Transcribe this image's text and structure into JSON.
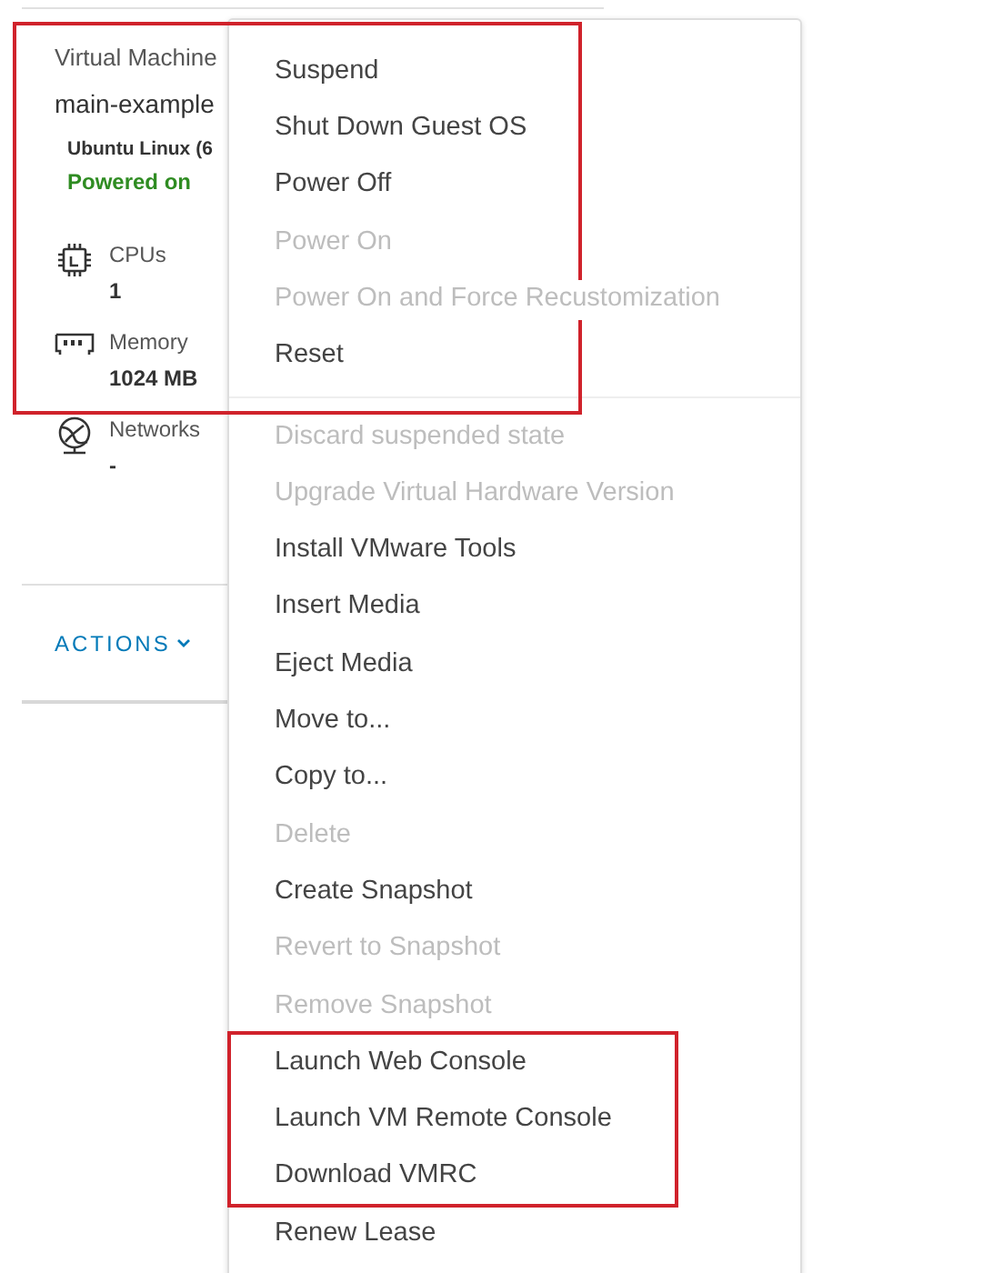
{
  "card": {
    "type_label": "Virtual Machine",
    "name": "main-example",
    "os": "Ubuntu Linux (6",
    "status": "Powered on",
    "specs": [
      {
        "kind": "cpu",
        "label": "CPUs",
        "value": "1"
      },
      {
        "kind": "memory",
        "label": "Memory",
        "value": "1024 MB"
      },
      {
        "kind": "network",
        "label": "Networks",
        "value": "-"
      }
    ],
    "actions_button": "ACTIONS"
  },
  "menu": {
    "sections": [
      [
        {
          "label": "Suspend",
          "disabled": false
        },
        {
          "label": "Shut Down Guest OS",
          "disabled": false
        },
        {
          "label": "Power Off",
          "disabled": false
        },
        {
          "label": "Power On",
          "disabled": true
        },
        {
          "label": "Power On and Force Recustomization",
          "disabled": true
        },
        {
          "label": "Reset",
          "disabled": false
        }
      ],
      [
        {
          "label": "Discard suspended state",
          "disabled": true
        },
        {
          "label": "Upgrade Virtual Hardware Version",
          "disabled": true
        },
        {
          "label": "Install VMware Tools",
          "disabled": false
        },
        {
          "label": "Insert Media",
          "disabled": false
        },
        {
          "label": "Eject Media",
          "disabled": false
        },
        {
          "label": "Move to...",
          "disabled": false
        },
        {
          "label": "Copy to...",
          "disabled": false
        },
        {
          "label": "Delete",
          "disabled": true
        },
        {
          "label": "Create Snapshot",
          "disabled": false
        },
        {
          "label": "Revert to Snapshot",
          "disabled": true
        },
        {
          "label": "Remove Snapshot",
          "disabled": true
        },
        {
          "label": "Launch Web Console",
          "disabled": false
        },
        {
          "label": "Launch VM Remote Console",
          "disabled": false
        },
        {
          "label": "Download VMRC",
          "disabled": false
        },
        {
          "label": "Renew Lease",
          "disabled": false
        }
      ]
    ]
  }
}
